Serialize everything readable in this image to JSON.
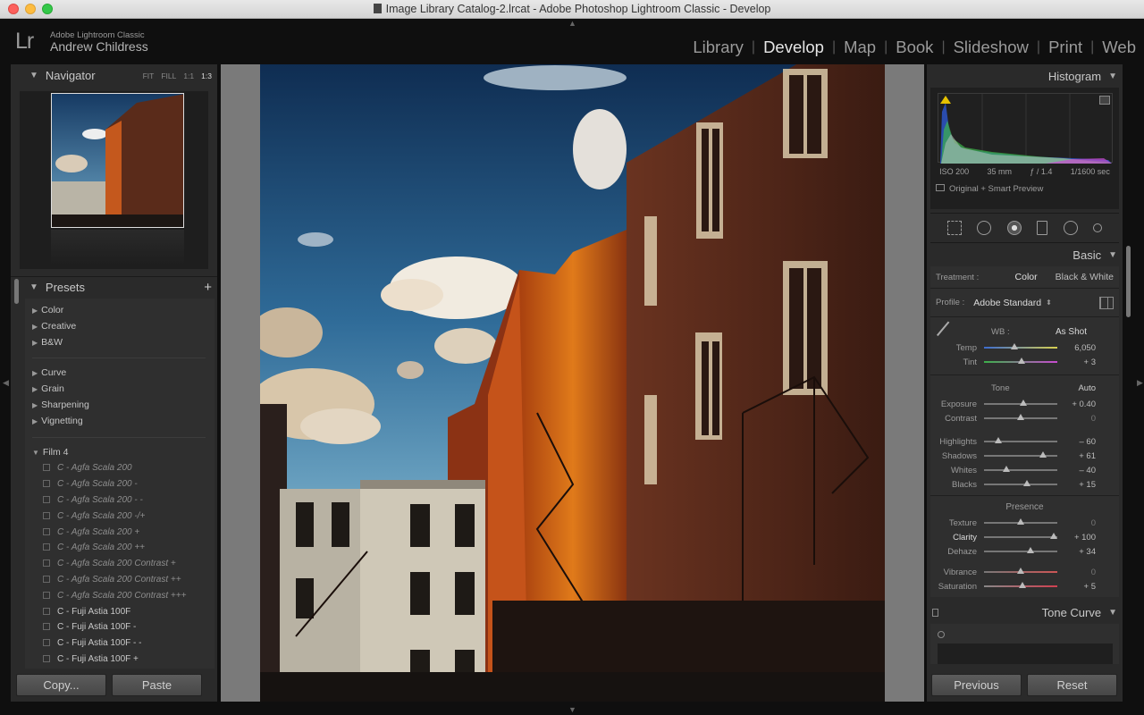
{
  "window": {
    "title": "Image Library Catalog-2.lrcat - Adobe Photoshop Lightroom Classic - Develop"
  },
  "identity": {
    "logo": "Lr",
    "app_name": "Adobe Lightroom Classic",
    "user": "Andrew Childress"
  },
  "modules": [
    {
      "label": "Library",
      "active": false
    },
    {
      "label": "Develop",
      "active": true
    },
    {
      "label": "Map",
      "active": false
    },
    {
      "label": "Book",
      "active": false
    },
    {
      "label": "Slideshow",
      "active": false
    },
    {
      "label": "Print",
      "active": false
    },
    {
      "label": "Web",
      "active": false
    }
  ],
  "navigator": {
    "title": "Navigator",
    "zoom_options": [
      "FIT",
      "FILL",
      "1:1",
      "1:3"
    ],
    "zoom_selected": "1:3"
  },
  "presets": {
    "title": "Presets",
    "add_label": "+",
    "groups_a": [
      "Color",
      "Creative",
      "B&W"
    ],
    "groups_b": [
      "Curve",
      "Grain",
      "Sharpening",
      "Vignetting"
    ],
    "open_group": "Film 4",
    "items": [
      {
        "label": "C - Agfa Scala 200",
        "italic": true
      },
      {
        "label": "C - Agfa Scala 200 -",
        "italic": true
      },
      {
        "label": "C - Agfa Scala 200 - -",
        "italic": true
      },
      {
        "label": "C - Agfa Scala 200 -/+",
        "italic": true
      },
      {
        "label": "C - Agfa Scala 200 +",
        "italic": true
      },
      {
        "label": "C - Agfa Scala 200 ++",
        "italic": true
      },
      {
        "label": "C - Agfa Scala 200 Contrast +",
        "italic": true
      },
      {
        "label": "C - Agfa Scala 200 Contrast ++",
        "italic": true
      },
      {
        "label": "C - Agfa Scala 200 Contrast +++",
        "italic": true
      },
      {
        "label": "C - Fuji Astia 100F",
        "italic": false
      },
      {
        "label": "C - Fuji Astia 100F -",
        "italic": false
      },
      {
        "label": "C - Fuji Astia 100F - -",
        "italic": false
      },
      {
        "label": "C - Fuji Astia 100F +",
        "italic": false
      }
    ]
  },
  "left_buttons": {
    "copy": "Copy...",
    "paste": "Paste"
  },
  "histogram": {
    "title": "Histogram",
    "iso": "ISO 200",
    "focal": "35 mm",
    "aperture": "ƒ / 1.4",
    "shutter": "1/1600 sec",
    "source": "Original + Smart Preview"
  },
  "basic": {
    "title": "Basic",
    "treatment_label": "Treatment :",
    "treatment_color": "Color",
    "treatment_bw": "Black & White",
    "profile_label": "Profile :",
    "profile_value": "Adobe Standard",
    "wb_label": "WB :",
    "wb_value": "As Shot",
    "wb_sliders": [
      {
        "label": "Temp",
        "value": "6,050",
        "pos": 0.42
      },
      {
        "label": "Tint",
        "value": "+ 3",
        "pos": 0.51
      }
    ],
    "tone_title": "Tone",
    "auto_label": "Auto",
    "tone_sliders_a": [
      {
        "label": "Exposure",
        "value": "+ 0.40",
        "pos": 0.54
      },
      {
        "label": "Contrast",
        "value": "0",
        "pos": 0.5
      }
    ],
    "tone_sliders_b": [
      {
        "label": "Highlights",
        "value": "– 60",
        "pos": 0.2
      },
      {
        "label": "Shadows",
        "value": "+ 61",
        "pos": 0.8
      },
      {
        "label": "Whites",
        "value": "– 40",
        "pos": 0.3
      },
      {
        "label": "Blacks",
        "value": "+ 15",
        "pos": 0.58
      }
    ],
    "presence_title": "Presence",
    "presence_sliders_a": [
      {
        "label": "Texture",
        "value": "0",
        "pos": 0.5
      },
      {
        "label": "Clarity",
        "value": "+ 100",
        "pos": 0.95
      },
      {
        "label": "Dehaze",
        "value": "+ 34",
        "pos": 0.64
      }
    ],
    "presence_sliders_b": [
      {
        "label": "Vibrance",
        "value": "0",
        "pos": 0.5
      },
      {
        "label": "Saturation",
        "value": "+ 5",
        "pos": 0.53
      }
    ]
  },
  "tone_curve": {
    "title": "Tone Curve"
  },
  "right_buttons": {
    "previous": "Previous",
    "reset": "Reset"
  }
}
